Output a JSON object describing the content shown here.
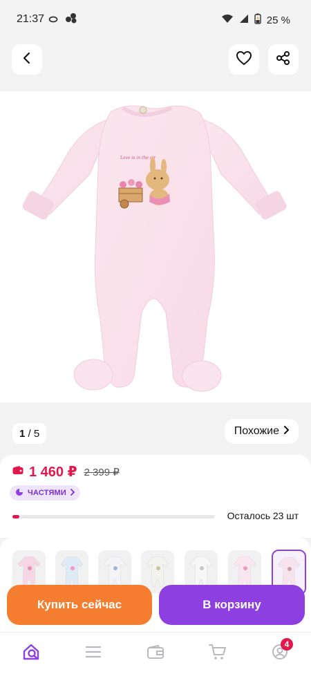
{
  "status_bar": {
    "time": "21:37",
    "battery_text": "25 %",
    "icons": [
      "sync-icon",
      "app-dots-icon",
      "wifi-icon",
      "signal-icon",
      "battery-icon"
    ]
  },
  "header": {
    "back_icon": "back-arrow-icon",
    "favorite_icon": "heart-icon",
    "share_icon": "share-icon"
  },
  "product": {
    "image_alt": "pink baby footed sleepsuit with bunny print",
    "print_text": "Love is in the air"
  },
  "gallery": {
    "current": "1",
    "separator": " / ",
    "total": "5",
    "similar_label": "Похожие",
    "similar_icon": "chevron-right-icon"
  },
  "price": {
    "current": "1 460 ₽",
    "old": "2 399 ₽",
    "wallet_icon": "wallet-icon",
    "installments_label": "ЧАСТЯМИ",
    "installments_icon": "pie-icon"
  },
  "stock": {
    "label": "Осталось 23 шт",
    "fill_fraction": 0.035,
    "color": "#e2184c"
  },
  "variants": {
    "count": 7,
    "selected_index": 6
  },
  "actions": {
    "buy_now": "Купить сейчас",
    "add_to_cart": "В корзину"
  },
  "bottom_nav": {
    "items": [
      "search-home-icon",
      "catalog-icon",
      "wallet-icon",
      "cart-icon",
      "profile-icon"
    ],
    "profile_badge": "4"
  },
  "colors": {
    "accent_purple": "#8e3fe0",
    "accent_orange": "#f57d2f",
    "price_red": "#e2184c"
  }
}
